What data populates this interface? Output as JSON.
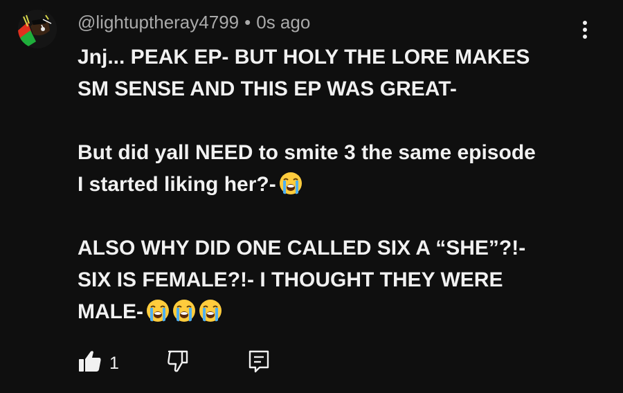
{
  "comment": {
    "handle": "@lightuptheray4799",
    "separator": "•",
    "time": "0s ago",
    "paragraphs": [
      {
        "lines": [
          {
            "text": "Jnj... PEAK EP- BUT HOLY THE LORE MAKES",
            "emojis": 0
          },
          {
            "text": "SM SENSE AND THIS EP WAS GREAT-",
            "emojis": 0
          }
        ]
      },
      {
        "lines": [
          {
            "text": "But did yall NEED to smite 3 the same episode",
            "emojis": 0
          },
          {
            "text": "I started liking her?-",
            "emojis": 1
          }
        ]
      },
      {
        "lines": [
          {
            "text": "ALSO WHY DID ONE CALLED SIX A “SHE”?!-",
            "emojis": 0
          },
          {
            "text": "SIX IS FEMALE?!- I THOUGHT THEY WERE",
            "emojis": 0
          },
          {
            "text": "MALE-",
            "emojis": 3
          }
        ]
      }
    ],
    "emoji_name": "loudly-crying-face",
    "like_count": "1"
  },
  "icons": {
    "like": "thumbs-up-icon",
    "dislike": "thumbs-down-icon",
    "reply": "reply-icon",
    "more": "more-vert-icon"
  },
  "colors": {
    "background": "#0f0f0f",
    "text": "#f1f1f1",
    "meta": "#aaaaaa"
  }
}
